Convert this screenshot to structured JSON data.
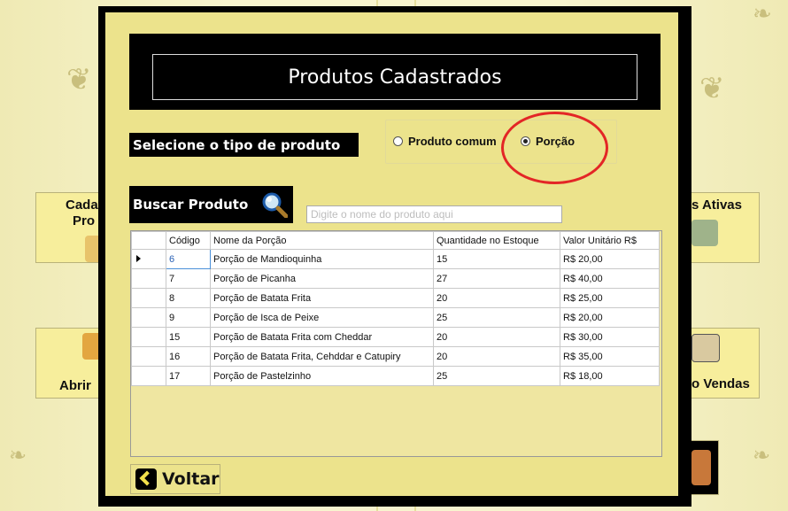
{
  "background": {
    "left_buttons": [
      {
        "label": "Cada",
        "label2": "Pro"
      },
      {
        "label": "Abrir"
      }
    ],
    "right_buttons": [
      {
        "label": "s Ativas"
      },
      {
        "label": "o Vendas"
      }
    ]
  },
  "dialog": {
    "title": "Produtos Cadastrados",
    "type_label": "Selecione o tipo de produto",
    "radio_options": [
      {
        "label": "Produto comum",
        "selected": false
      },
      {
        "label": "Porção",
        "selected": true
      }
    ],
    "search": {
      "label": "Buscar Produto",
      "placeholder": "Digite o nome do produto aqui",
      "icon": "magnifier-icon"
    },
    "table": {
      "columns": [
        "Código",
        "Nome da Porção",
        "Quantidade no Estoque",
        "Valor Unitário R$"
      ],
      "rows": [
        [
          "6",
          "Porção de Mandioquinha",
          "15",
          "R$ 20,00"
        ],
        [
          "7",
          "Porção de Picanha",
          "27",
          "R$ 40,00"
        ],
        [
          "8",
          "Porção de Batata Frita",
          "20",
          "R$ 25,00"
        ],
        [
          "9",
          "Porção de Isca de Peixe",
          "25",
          "R$ 20,00"
        ],
        [
          "15",
          "Porção de Batata Frita com Cheddar",
          "20",
          "R$ 30,00"
        ],
        [
          "16",
          "Porção de Batata Frita, Cehddar e Catupiry",
          "20",
          "R$ 35,00"
        ],
        [
          "17",
          "Porção de Pastelzinho",
          "25",
          "R$ 18,00"
        ]
      ]
    },
    "back_button": {
      "label": "Voltar",
      "icon": "chevron-left-icon"
    },
    "highlight_color": "#e32626"
  }
}
